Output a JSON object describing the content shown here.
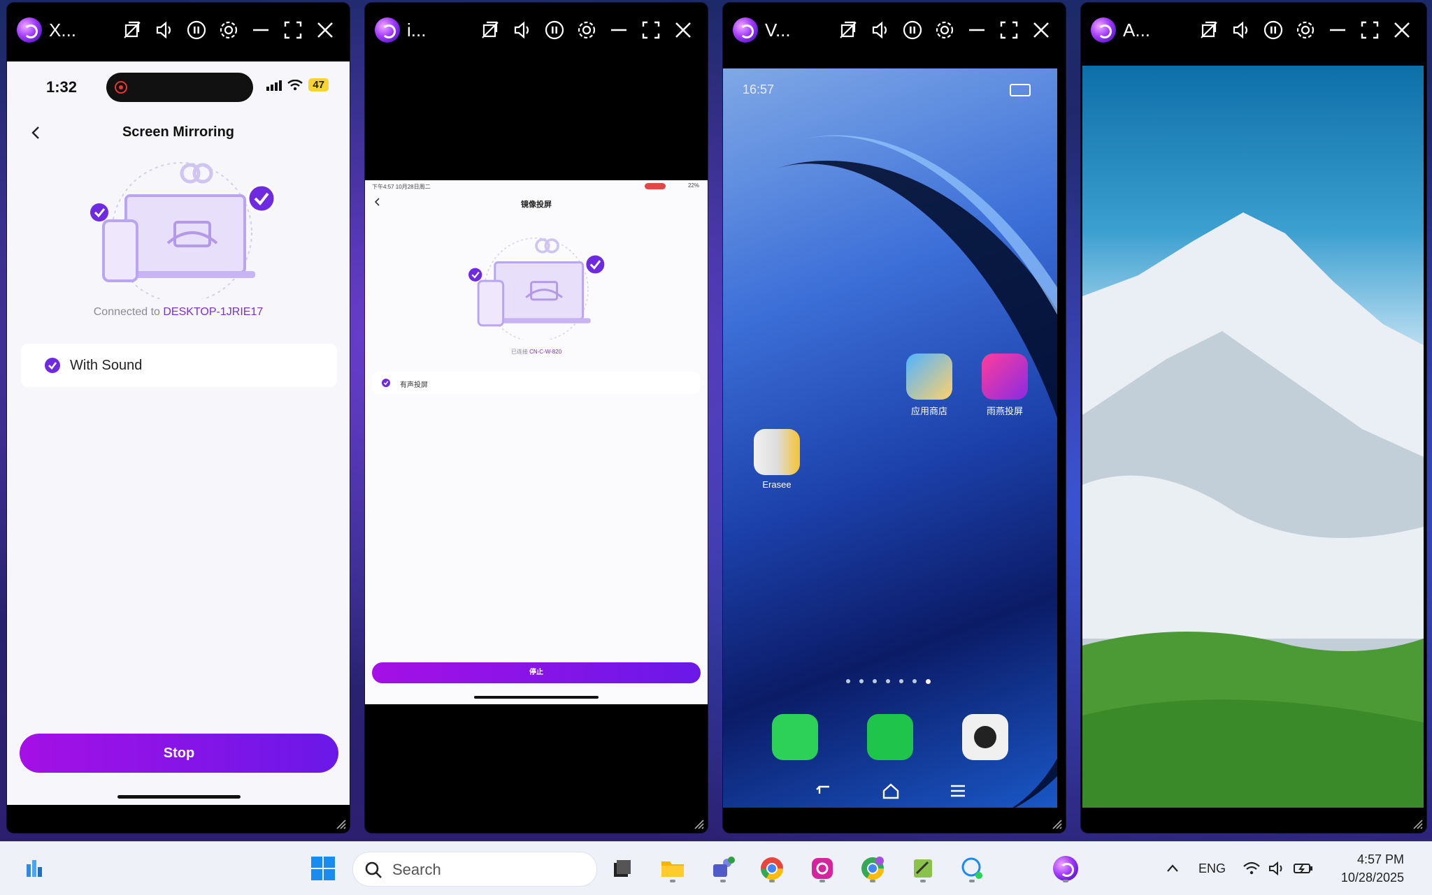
{
  "windows": [
    {
      "title": "X..."
    },
    {
      "title": "i..."
    },
    {
      "title": "V..."
    },
    {
      "title": "A..."
    }
  ],
  "phone1": {
    "time": "1:32",
    "battery": "47",
    "nav_title": "Screen Mirroring",
    "connected_prefix": "Connected to ",
    "device_name": "DESKTOP-1JRIE17",
    "with_sound_label": "With Sound",
    "stop_label": "Stop"
  },
  "phone2": {
    "status_time": "下午4:57  10月28日周二",
    "battery": "22%",
    "nav_title": "镜像投屏",
    "connected_prefix": "已连接 ",
    "device_name": "CN-C-W-820",
    "with_sound_label": "有声投屏",
    "stop_label": "停止"
  },
  "phone3": {
    "time": "16:57",
    "apps": [
      {
        "label": "应用商店",
        "icon": "app-store-icon"
      },
      {
        "label": "雨燕投屏",
        "icon": "screen-cast-app-icon"
      },
      {
        "label": "Erasee",
        "icon": "erasee-app-icon"
      }
    ],
    "dock": [
      "phone-icon",
      "wechat-icon",
      "camera-icon"
    ]
  },
  "taskbar": {
    "search_placeholder": "Search",
    "language": "ENG",
    "time": "4:57 PM",
    "date": "10/28/2025"
  },
  "colors": {
    "accent": "#7a2fd6",
    "button_gradient_start": "#a510e6",
    "button_gradient_end": "#6a18e8"
  }
}
